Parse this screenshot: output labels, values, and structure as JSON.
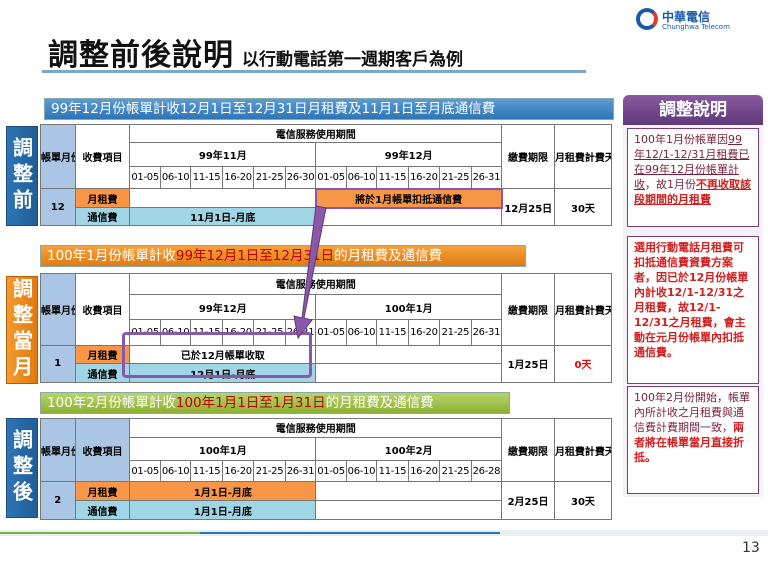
{
  "title": "調整前後說明",
  "subtitle": "以行動電話第一週期客戶為例",
  "logo": {
    "cn": "中華電信",
    "en": "Chunghwa Telecom"
  },
  "colors": {
    "blue": "#2e75b6",
    "orange": "#f79646",
    "cyan": "#9fd5e4",
    "purple": "#5f3a7a",
    "red": "#d01f1f"
  },
  "common": {
    "period_header": "電信服務使用期間",
    "billing_month": "帳單月份",
    "item": "收費項目",
    "due": "繳費期限",
    "days_header": "月租費計費天數",
    "rent": "月租費",
    "comm": "通信費"
  },
  "sections": [
    {
      "banner_a": "99年12月份帳單計收",
      "banner_b": "12月1日至12月31日",
      "banner_c": "月租費及11月1日至月底通信費",
      "side": "調整前",
      "month1": "99年11月",
      "month2": "99年12月",
      "days1": [
        "01-05",
        "06-10",
        "11-15",
        "16-20",
        "21-25",
        "26-30"
      ],
      "days2": [
        "01-05",
        "06-10",
        "11-15",
        "16-20",
        "21-25",
        "26-31"
      ],
      "bill_month": "12",
      "rent_text": "將於1月帳單扣抵通信費",
      "comm_text": "11月1日-月底",
      "due": "12月25日",
      "days": "30天"
    },
    {
      "banner_a": "100年1月份帳單計收",
      "banner_b": "99年12月1日至12月31日",
      "banner_c": "的月租費及通信費",
      "side": "調整當月",
      "month1": "99年12月",
      "month2": "100年1月",
      "days1": [
        "01-05",
        "06-10",
        "11-15",
        "16-20",
        "21-25",
        "26-31"
      ],
      "days2": [
        "01-05",
        "06-10",
        "11-15",
        "16-20",
        "21-25",
        "26-31"
      ],
      "bill_month": "1",
      "rent_text": "已於12月帳單收取",
      "comm_text": "12月1日-月底",
      "due": "1月25日",
      "days": "0天"
    },
    {
      "banner_a": "100年2月份帳單計收",
      "banner_b": "100年1月1日至1月31日",
      "banner_c": "的月租費及通信費",
      "side": "調整後",
      "month1": "100年1月",
      "month2": "100年2月",
      "days1": [
        "01-05",
        "06-10",
        "11-15",
        "16-20",
        "21-25",
        "26-31"
      ],
      "days2": [
        "01-05",
        "06-10",
        "11-15",
        "16-20",
        "21-25",
        "26-28"
      ],
      "bill_month": "2",
      "rent_text": "1月1日-月底",
      "comm_text": "1月1日-月底",
      "due": "2月25日",
      "days": "30天"
    }
  ],
  "panel": {
    "title": "調整說明",
    "box1_a": "100年1月份帳單因",
    "box1_b": "99年12/1-12/31月租費已在99年12月份帳單計收",
    "box1_c": "，故1月份",
    "box1_d": "不再收取該段期間的月租費",
    "box2": "選用行動電話月租費可扣抵通信費資費方案者，因已於12月份帳單內計收12/1-12/31之月租費，故12/1-12/31之月租費，會主動在元月份帳單內扣抵通信費。",
    "box3_a": "100年2月份開始，帳單內所計收之月租費與通信費計費期間一致，",
    "box3_b": "兩者將在帳單當月直接折抵。"
  },
  "page_number": "13"
}
